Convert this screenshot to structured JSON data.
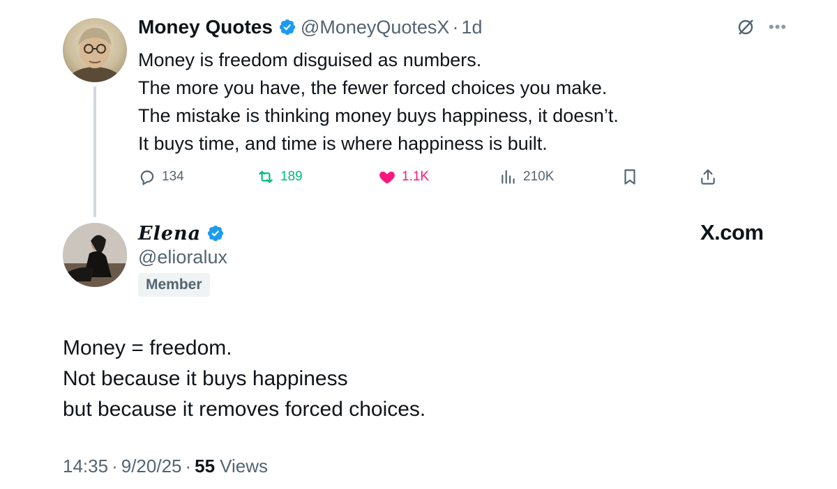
{
  "quoted_tweet": {
    "author_name": "Money Quotes",
    "handle": "@MoneyQuotesX",
    "separator": "·",
    "time": "1d",
    "lines": [
      "Money is freedom disguised as numbers.",
      "The more you have, the fewer forced choices you make.",
      "The mistake is thinking money buys happiness, it doesn’t.",
      "It buys time, and time is where happiness is built."
    ],
    "stats": {
      "replies": "134",
      "reposts": "189",
      "likes": "1.1K",
      "views": "210K"
    },
    "icons": [
      "reply-icon",
      "repost-icon",
      "heart-icon",
      "views-icon",
      "bookmark-icon",
      "share-icon",
      "grok-icon",
      "more-icon",
      "verified-icon"
    ]
  },
  "reply_tweet": {
    "author_name": "Elena",
    "handle": "@elioralux",
    "badge": "Member",
    "watermark": "X.com",
    "lines": [
      "Money = freedom.",
      "Not because it buys happiness",
      "but because it removes forced choices."
    ],
    "meta": {
      "time": "14:35",
      "date": "9/20/25",
      "separator": "·",
      "views_count": "55",
      "views_label": "Views"
    }
  },
  "colors": {
    "verified_blue": "#1d9bf0",
    "repost_green": "#00ba7c",
    "like_pink": "#f91880",
    "secondary_text": "#536471",
    "thread_line": "#cfd9de"
  }
}
